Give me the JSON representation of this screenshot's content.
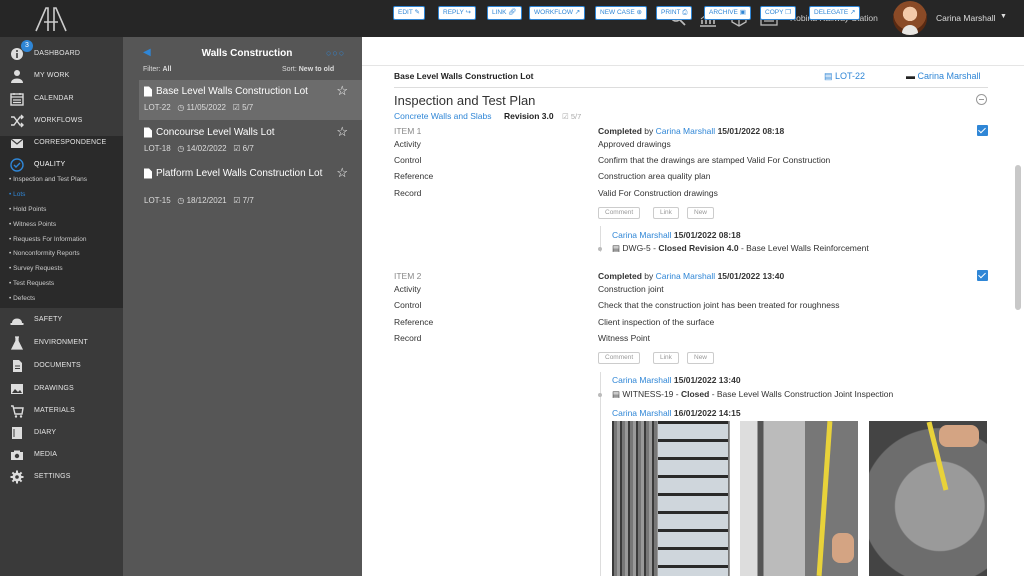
{
  "top": {
    "station": "Robina Railway Station",
    "user": "Carina Marshall",
    "icons": [
      "search-icon",
      "chart-icon",
      "cube-icon",
      "list-icon"
    ]
  },
  "sidebar": {
    "badge": "3",
    "items": [
      {
        "label": "DASHBOARD"
      },
      {
        "label": "MY WORK"
      },
      {
        "label": "CALENDAR"
      },
      {
        "label": "WORKFLOWS"
      },
      {
        "label": "CORRESPONDENCE"
      },
      {
        "label": "QUALITY"
      },
      {
        "label": "SAFETY"
      },
      {
        "label": "ENVIRONMENT"
      },
      {
        "label": "DOCUMENTS"
      },
      {
        "label": "DRAWINGS"
      },
      {
        "label": "MATERIALS"
      },
      {
        "label": "DIARY"
      },
      {
        "label": "MEDIA"
      },
      {
        "label": "SETTINGS"
      }
    ],
    "quality_sub": [
      {
        "label": "Inspection and Test Plans"
      },
      {
        "label": "Lots"
      },
      {
        "label": "Hold Points"
      },
      {
        "label": "Witness Points"
      },
      {
        "label": "Requests For Information"
      },
      {
        "label": "Nonconformity Reports"
      },
      {
        "label": "Survey Requests"
      },
      {
        "label": "Test Requests"
      },
      {
        "label": "Defects"
      }
    ]
  },
  "list": {
    "title": "Walls Construction",
    "filter_label": "Filter:",
    "filter_value": "All",
    "sort_label": "Sort:",
    "sort_value": "New to old",
    "rows": [
      {
        "title": "Base Level Walls Construction Lot",
        "ref": "LOT-22",
        "date": "11/05/2022",
        "count": "5/7"
      },
      {
        "title": "Concourse Level Walls Lot",
        "ref": "LOT-18",
        "date": "14/02/2022",
        "count": "6/7"
      },
      {
        "title": "Platform Level Walls Construction Lot",
        "ref": "LOT-15",
        "date": "18/12/2021",
        "count": "7/7"
      }
    ]
  },
  "toolbar": {
    "buttons": [
      "EDIT",
      "REPLY",
      "LINK",
      "WORKFLOW",
      "NEW CASE",
      "PRINT",
      "ARCHIVE",
      "COPY",
      "DELEGATE"
    ]
  },
  "detail": {
    "lot_title": "Base Level Walls Construction Lot",
    "lot_ref": "LOT-22",
    "owner": "Carina Marshall",
    "itp_title": "Inspection and Test Plan",
    "itp_name": "Concrete Walls and Slabs",
    "itp_revision": "Revision 3.0",
    "itp_count": "5/7",
    "labels": {
      "activity": "Activity",
      "control": "Control",
      "reference": "Reference",
      "record": "Record"
    },
    "buttons": {
      "comment": "Comment",
      "link": "Link",
      "new": "New"
    },
    "items": [
      {
        "number": "ITEM 1",
        "status": "Completed",
        "by": "by",
        "user": "Carina Marshall",
        "datetime": "15/01/2022  08:18",
        "activity": "Approved drawings",
        "control": "Confirm that the drawings are stamped Valid For Construction",
        "reference": "Construction area quality plan",
        "record": "Valid For Construction drawings",
        "links": [
          {
            "user": "Carina Marshall",
            "datetime": "15/01/2022 08:18",
            "doc": "DWG-5",
            "sep": " - ",
            "state": "Closed Revision 4.0",
            "desc": " - Base Level Walls Reinforcement"
          }
        ]
      },
      {
        "number": "ITEM 2",
        "status": "Completed",
        "by": "by",
        "user": "Carina Marshall",
        "datetime": "15/01/2022  13:40",
        "activity": "Construction joint",
        "control": "Check that the construction joint has been treated for roughness",
        "reference": "Client inspection of the surface",
        "record": "Witness Point",
        "links": [
          {
            "user": "Carina Marshall",
            "datetime": "15/01/2022 13:40",
            "doc": "WITNESS-19",
            "sep": " - ",
            "state": "Closed",
            "desc": " - Base Level Walls Construction Joint Inspection"
          },
          {
            "user": "Carina Marshall",
            "datetime": "16/01/2022 14:15"
          }
        ]
      }
    ]
  },
  "colors": {
    "accent": "#2f86d6",
    "topbar": "#262626",
    "sidebar": "#3a3a3a",
    "list": "#565656"
  }
}
